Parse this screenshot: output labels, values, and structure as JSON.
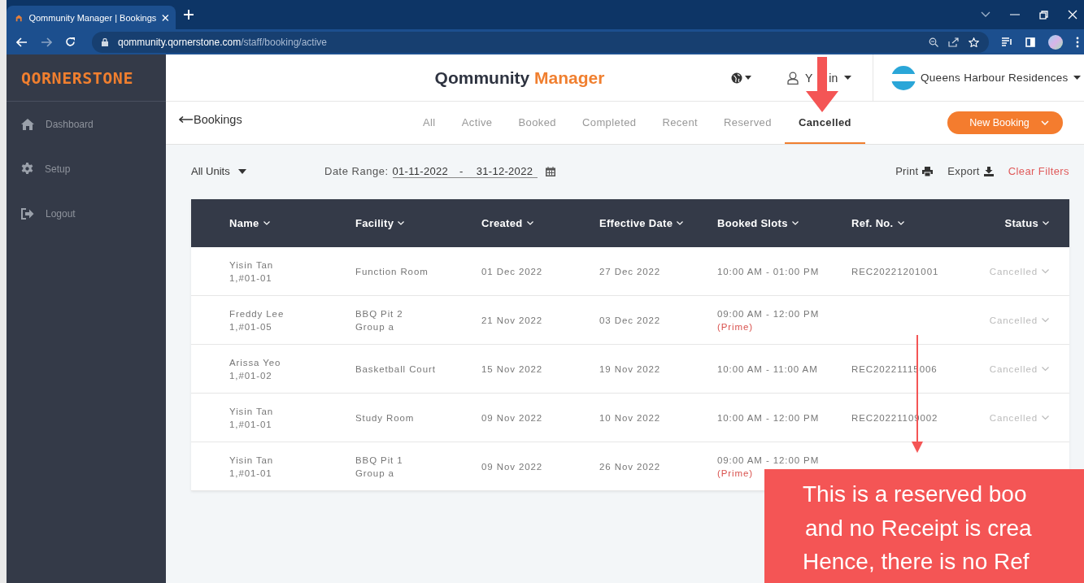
{
  "browser": {
    "tab_title": "Qommunity Manager | Bookings",
    "url_host": "qommunity.qornerstone.com",
    "url_path": "/staff/booking/active"
  },
  "sidebar": {
    "logo": "QORNERSTONE",
    "items": [
      {
        "label": "Dashboard"
      },
      {
        "label": "Setup"
      },
      {
        "label": "Logout"
      }
    ]
  },
  "header": {
    "title": "Qommunity",
    "title_accent": "Manager",
    "user_start": "Y",
    "user_end": "in",
    "property": "Queens Harbour Residences"
  },
  "page": {
    "back_label": "Bookings",
    "new_button": "New Booking"
  },
  "tabs": [
    {
      "label": "All",
      "selected": false
    },
    {
      "label": "Active",
      "selected": false
    },
    {
      "label": "Booked",
      "selected": false
    },
    {
      "label": "Completed",
      "selected": false
    },
    {
      "label": "Recent",
      "selected": false
    },
    {
      "label": "Reserved",
      "selected": false
    },
    {
      "label": "Cancelled",
      "selected": true
    }
  ],
  "filters": {
    "units": "All Units",
    "date_label": "Date Range:",
    "date_from": "01-11-2022",
    "date_sep": "-",
    "date_to": "31-12-2022",
    "print": "Print",
    "export": "Export",
    "clear": "Clear Filters"
  },
  "table": {
    "columns": [
      "Name",
      "Facility",
      "Created",
      "Effective Date",
      "Booked Slots",
      "Ref. No.",
      "Status"
    ],
    "rows": [
      {
        "name": "Yisin Tan",
        "unit": "1,#01-01",
        "facility": [
          "Function Room"
        ],
        "created": "01 Dec 2022",
        "effective": "27 Dec 2022",
        "slot": "10:00 AM - 01:00 PM",
        "ref": "REC20221201001",
        "status": "Cancelled"
      },
      {
        "name": "Freddy Lee",
        "unit": "1,#01-05",
        "facility": [
          "BBQ Pit 2",
          "Group a"
        ],
        "created": "21 Nov 2022",
        "effective": "03 Dec 2022",
        "slot": "09:00 AM - 12:00 PM",
        "prime": "(Prime)",
        "status": "Cancelled"
      },
      {
        "name": "Arissa Yeo",
        "unit": "1,#01-02",
        "facility": [
          "Basketball Court"
        ],
        "created": "15 Nov 2022",
        "effective": "19 Nov 2022",
        "slot": "10:00 AM - 11:00 AM",
        "ref": "REC20221115006",
        "status": "Cancelled"
      },
      {
        "name": "Yisin Tan",
        "unit": "1,#01-01",
        "facility": [
          "Study Room"
        ],
        "created": "09 Nov 2022",
        "effective": "10 Nov 2022",
        "slot": "10:00 AM - 12:00 PM",
        "ref": "REC20221109002",
        "status": "Cancelled"
      },
      {
        "name": "Yisin Tan",
        "unit": "1,#01-01",
        "facility": [
          "BBQ Pit 1",
          "Group a"
        ],
        "created": "09 Nov 2022",
        "effective": "26 Nov 2022",
        "slot": "09:00 AM - 12:00 PM",
        "prime": "(Prime)"
      }
    ]
  },
  "annotation": {
    "lines": [
      "This is a reserved boo",
      "and no Receipt is crea",
      "Hence, there is no Ref"
    ]
  }
}
